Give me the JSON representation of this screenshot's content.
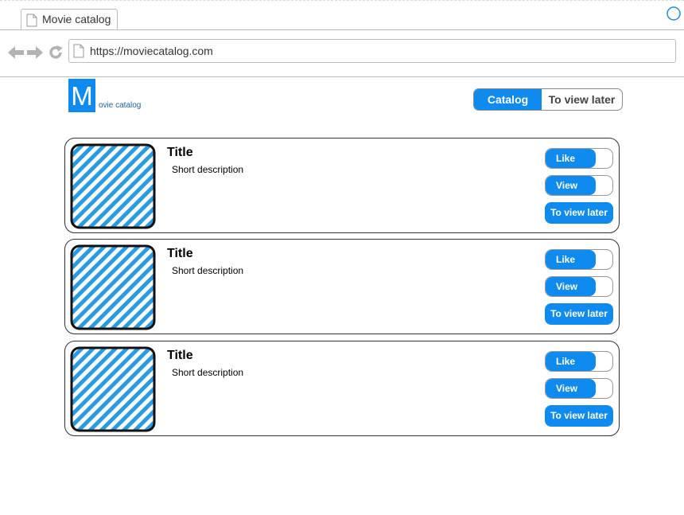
{
  "browser": {
    "tab_title": "Movie catalog",
    "url": "https://moviecatalog.com"
  },
  "header": {
    "logo_letter": "M",
    "logo_rest": "ovie catalog",
    "nav": [
      {
        "label": "Catalog",
        "active": true
      },
      {
        "label": "To view later",
        "active": false
      }
    ]
  },
  "movies": [
    {
      "title": "Title",
      "description": "Short description",
      "like_label": "Like",
      "view_label": "View",
      "later_label": "To view later"
    },
    {
      "title": "Title",
      "description": "Short description",
      "like_label": "Like",
      "view_label": "View",
      "later_label": "To view later"
    },
    {
      "title": "Title",
      "description": "Short description",
      "like_label": "Like",
      "view_label": "View",
      "later_label": "To view later"
    }
  ],
  "colors": {
    "accent": "#0f8aef",
    "placeholder_stripe": "#2b9be0"
  },
  "icons": [
    "page-icon",
    "loading-icon",
    "back-arrow-icon",
    "forward-arrow-icon",
    "reload-icon",
    "image-placeholder-icon"
  ]
}
